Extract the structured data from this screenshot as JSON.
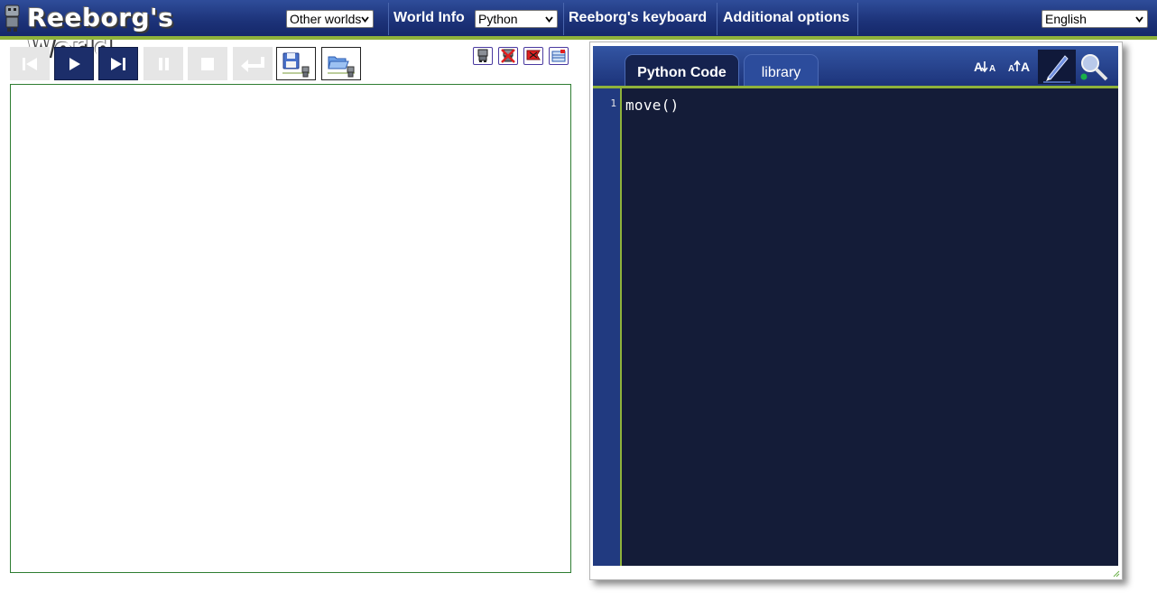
{
  "header": {
    "logo_text": "Reeborg's World",
    "worlds_select": "Other worlds",
    "world_info": "World Info",
    "language_select": "Python",
    "keyboard": "Reeborg's keyboard",
    "additional_options": "Additional options",
    "ui_language_select": "English"
  },
  "toolbar": {
    "buttons": [
      {
        "name": "reverse-step-button",
        "icon": "skip-back-icon",
        "state": "disabled"
      },
      {
        "name": "run-button",
        "icon": "play-icon",
        "state": "active"
      },
      {
        "name": "step-button",
        "icon": "step-forward-icon",
        "state": "active"
      },
      {
        "name": "pause-button",
        "icon": "pause-icon",
        "state": "disabled"
      },
      {
        "name": "stop-button",
        "icon": "stop-icon",
        "state": "disabled"
      },
      {
        "name": "reload-button",
        "icon": "return-icon",
        "state": "disabled"
      },
      {
        "name": "save-program-button",
        "icon": "floppy-disk-icon",
        "state": "enabled"
      },
      {
        "name": "load-program-button",
        "icon": "open-folder-icon",
        "state": "enabled"
      }
    ],
    "mini_buttons": [
      {
        "name": "robot-view-button",
        "icon": "robot-icon"
      },
      {
        "name": "remove-robot-button",
        "icon": "robot-delete-icon"
      },
      {
        "name": "flag-button",
        "icon": "red-flag-icon"
      },
      {
        "name": "world-edit-button",
        "icon": "world-edit-icon"
      }
    ]
  },
  "editor": {
    "tabs": [
      {
        "label": "Python Code",
        "active": true
      },
      {
        "label": "library",
        "active": false
      }
    ],
    "tools": [
      {
        "name": "decrease-font-button",
        "label": "A↓A"
      },
      {
        "name": "increase-font-button",
        "label": "A↑A"
      },
      {
        "name": "highlight-button",
        "icon": "pen-icon"
      },
      {
        "name": "watch-variables-button",
        "icon": "magnifier-icon"
      }
    ],
    "lines": [
      {
        "number": "1",
        "code": "move()"
      }
    ]
  },
  "colors": {
    "header_blue": "#1c3278",
    "accent_green": "#8fb23b",
    "editor_bg": "#141c38",
    "gutter_bg": "#213a80",
    "world_border": "#2e7d32"
  }
}
